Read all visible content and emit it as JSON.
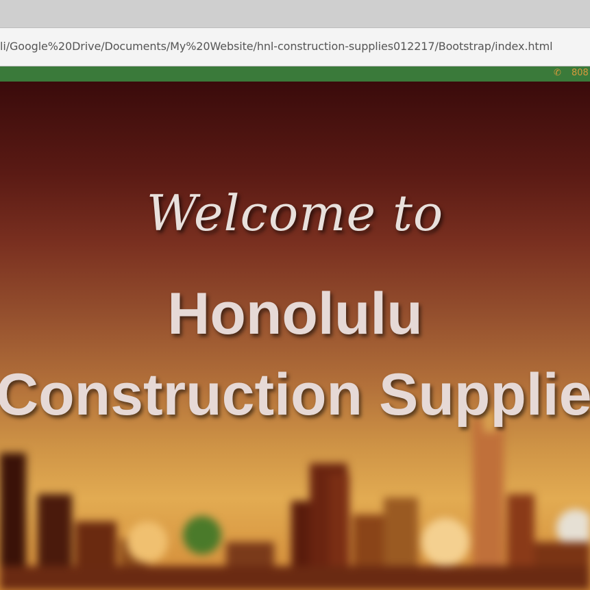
{
  "browser": {
    "address": "li/Google%20Drive/Documents/My%20Website/hnl-construction-supplies012217/Bootstrap/index.html"
  },
  "top_bar": {
    "phone_icon": "phone-icon",
    "phone_text": "808",
    "color": "#3a7a3a"
  },
  "hero": {
    "welcome": "Welcome to",
    "title_line1": "Honolulu",
    "title_line2": "Construction Supplies"
  }
}
